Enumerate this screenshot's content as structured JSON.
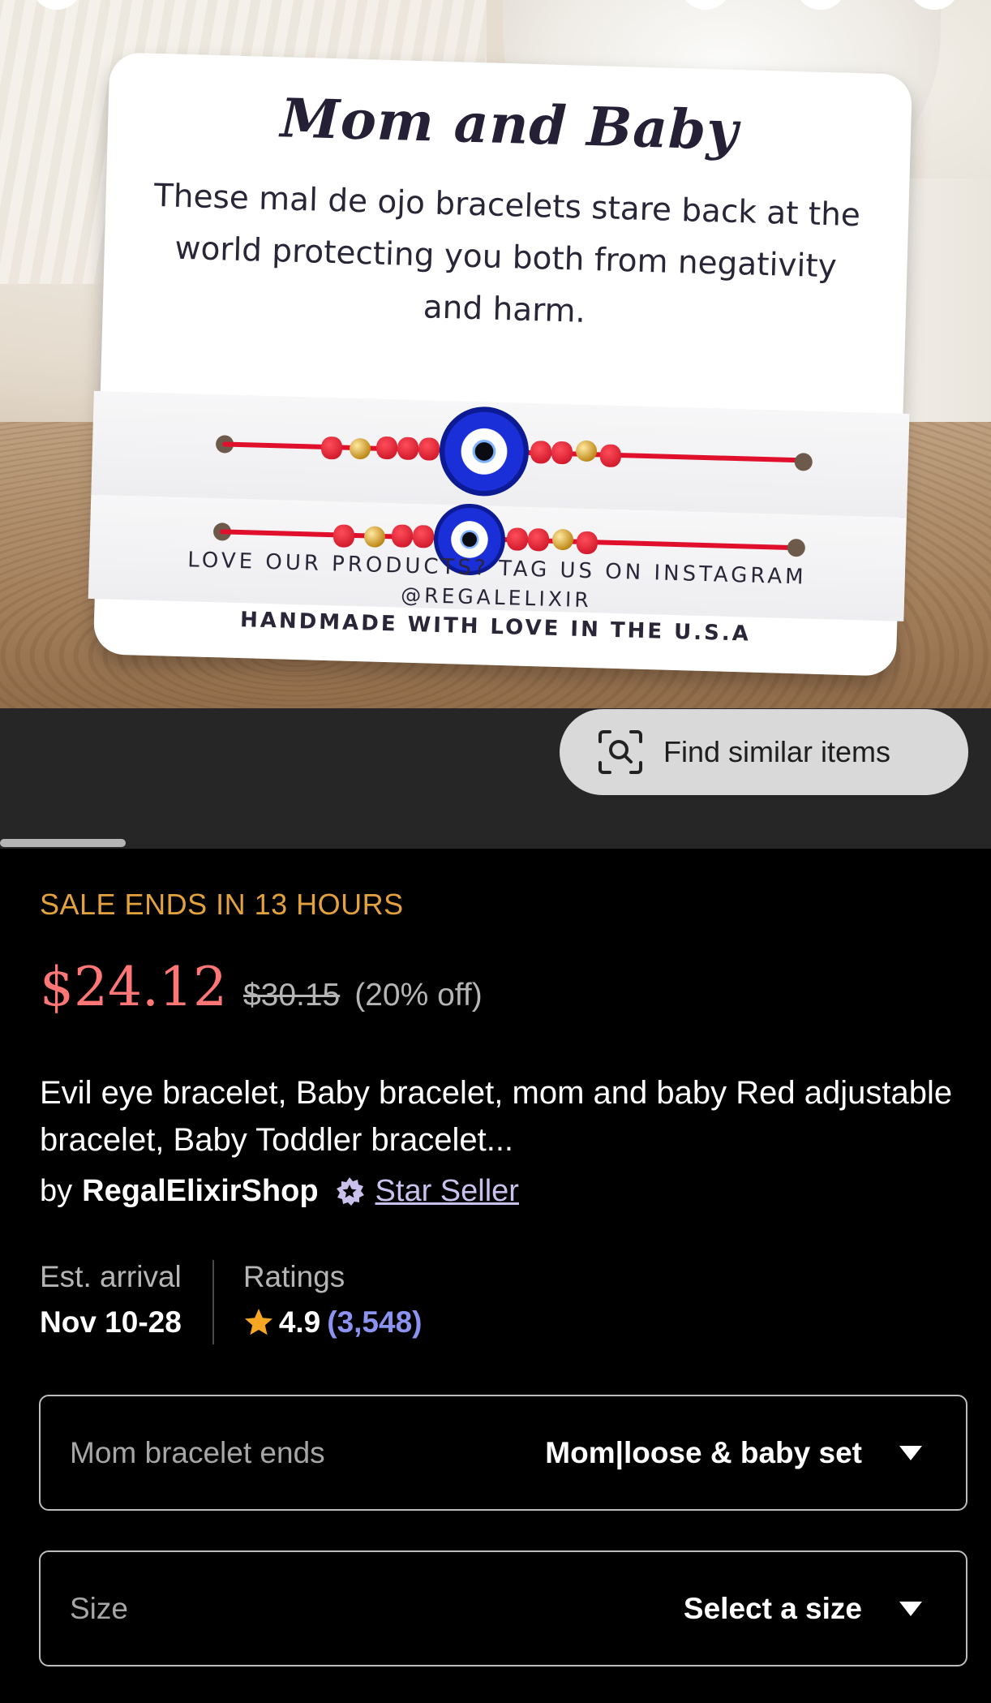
{
  "photo": {
    "card_title": "Mom and Baby",
    "card_text": "These mal de ojo bracelets stare back at the world protecting you both from negativity and harm.",
    "card_footer_line1": "LOVE OUR PRODUCTS? TAG US ON INSTAGRAM",
    "card_footer_line2": "@REGALELIXIR",
    "card_footer_line3": "HANDMADE WITH LOVE IN THE U.S.A"
  },
  "find_similar": {
    "label": "Find similar items",
    "icon": "image-search-icon"
  },
  "sale": {
    "banner": "SALE ENDS IN 13 HOURS"
  },
  "price": {
    "current": "$24.12",
    "original": "$30.15",
    "discount": "(20% off)"
  },
  "product": {
    "title": "Evil eye bracelet, Baby bracelet, mom and baby Red adjustable bracelet, Baby Toddler bracelet..."
  },
  "seller": {
    "by": "by",
    "shop": "RegalElixirShop",
    "badge_label": "Star Seller",
    "badge_icon": "star-seller-badge-icon"
  },
  "arrival": {
    "label": "Est. arrival",
    "value": "Nov 10-28"
  },
  "ratings": {
    "label": "Ratings",
    "score": "4.9",
    "count": "(3,548)"
  },
  "options": [
    {
      "label": "Mom bracelet ends",
      "value": "Mom|loose & baby set"
    },
    {
      "label": "Size",
      "value": "Select a size"
    }
  ],
  "colors": {
    "sale": "#e4a23f",
    "price": "#ff7676",
    "link": "#8a93f0",
    "star": "#f5a623"
  }
}
